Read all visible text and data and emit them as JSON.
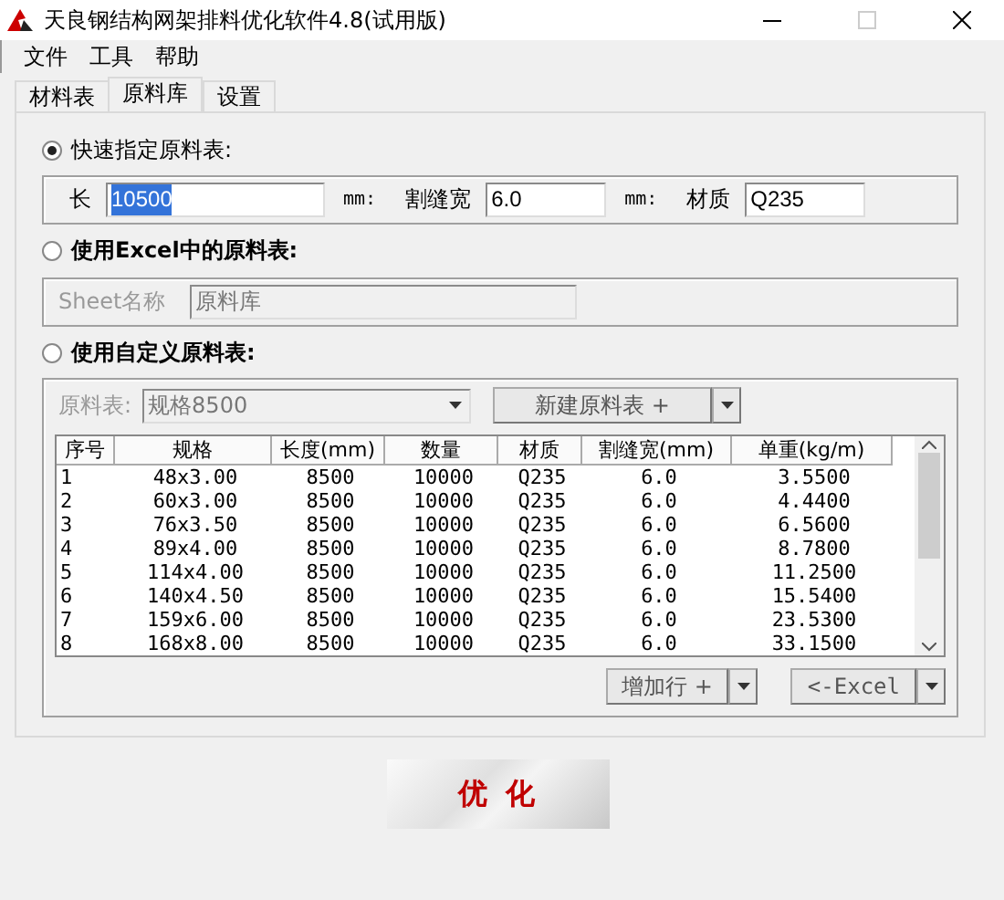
{
  "window": {
    "title": "天良钢结构网架排料优化软件4.8(试用版)"
  },
  "menu": [
    "文件",
    "工具",
    "帮助"
  ],
  "tabs": [
    {
      "label": "材料表",
      "selected": false
    },
    {
      "label": "原料库",
      "selected": true
    },
    {
      "label": "设置",
      "selected": false
    }
  ],
  "quick": {
    "label": "快速指定原料表:",
    "selected": true,
    "disabled": false,
    "fields": [
      {
        "label": "长",
        "value": "10500",
        "unit": "mm:",
        "highlighted": true
      },
      {
        "label": "割缝宽",
        "value": "6.0",
        "unit": "mm:",
        "highlighted": false
      },
      {
        "label": "材质",
        "value": "Q235",
        "highlighted": false
      }
    ]
  },
  "excel": {
    "label": "使用Excel中的原料表:",
    "selected": false,
    "disabled": true,
    "sheet_label": "Sheet名称",
    "sheet_value": "原料库"
  },
  "custom": {
    "label": "使用自定义原料表:",
    "selected": false,
    "disabled": true,
    "table_label": "原料表:",
    "table_value": "规格8500",
    "new_button": "新建原料表 +",
    "columns": [
      "序号",
      "规格",
      "长度(mm)",
      "数量",
      "材质",
      "割缝宽(mm)",
      "单重(kg/m)"
    ],
    "rows": [
      [
        "1",
        "48x3.00",
        "8500",
        "10000",
        "Q235",
        "6.0",
        "3.5500"
      ],
      [
        "2",
        "60x3.00",
        "8500",
        "10000",
        "Q235",
        "6.0",
        "4.4400"
      ],
      [
        "3",
        "76x3.50",
        "8500",
        "10000",
        "Q235",
        "6.0",
        "6.5600"
      ],
      [
        "4",
        "89x4.00",
        "8500",
        "10000",
        "Q235",
        "6.0",
        "8.7800"
      ],
      [
        "5",
        "114x4.00",
        "8500",
        "10000",
        "Q235",
        "6.0",
        "11.2500"
      ],
      [
        "6",
        "140x4.50",
        "8500",
        "10000",
        "Q235",
        "6.0",
        "15.5400"
      ],
      [
        "7",
        "159x6.00",
        "8500",
        "10000",
        "Q235",
        "6.0",
        "23.5300"
      ],
      [
        "8",
        "168x8.00",
        "8500",
        "10000",
        "Q235",
        "6.0",
        "33.1500"
      ]
    ],
    "add_row_button": "增加行 +",
    "excel_button": "<-Excel"
  },
  "optimize_button": "优 化"
}
